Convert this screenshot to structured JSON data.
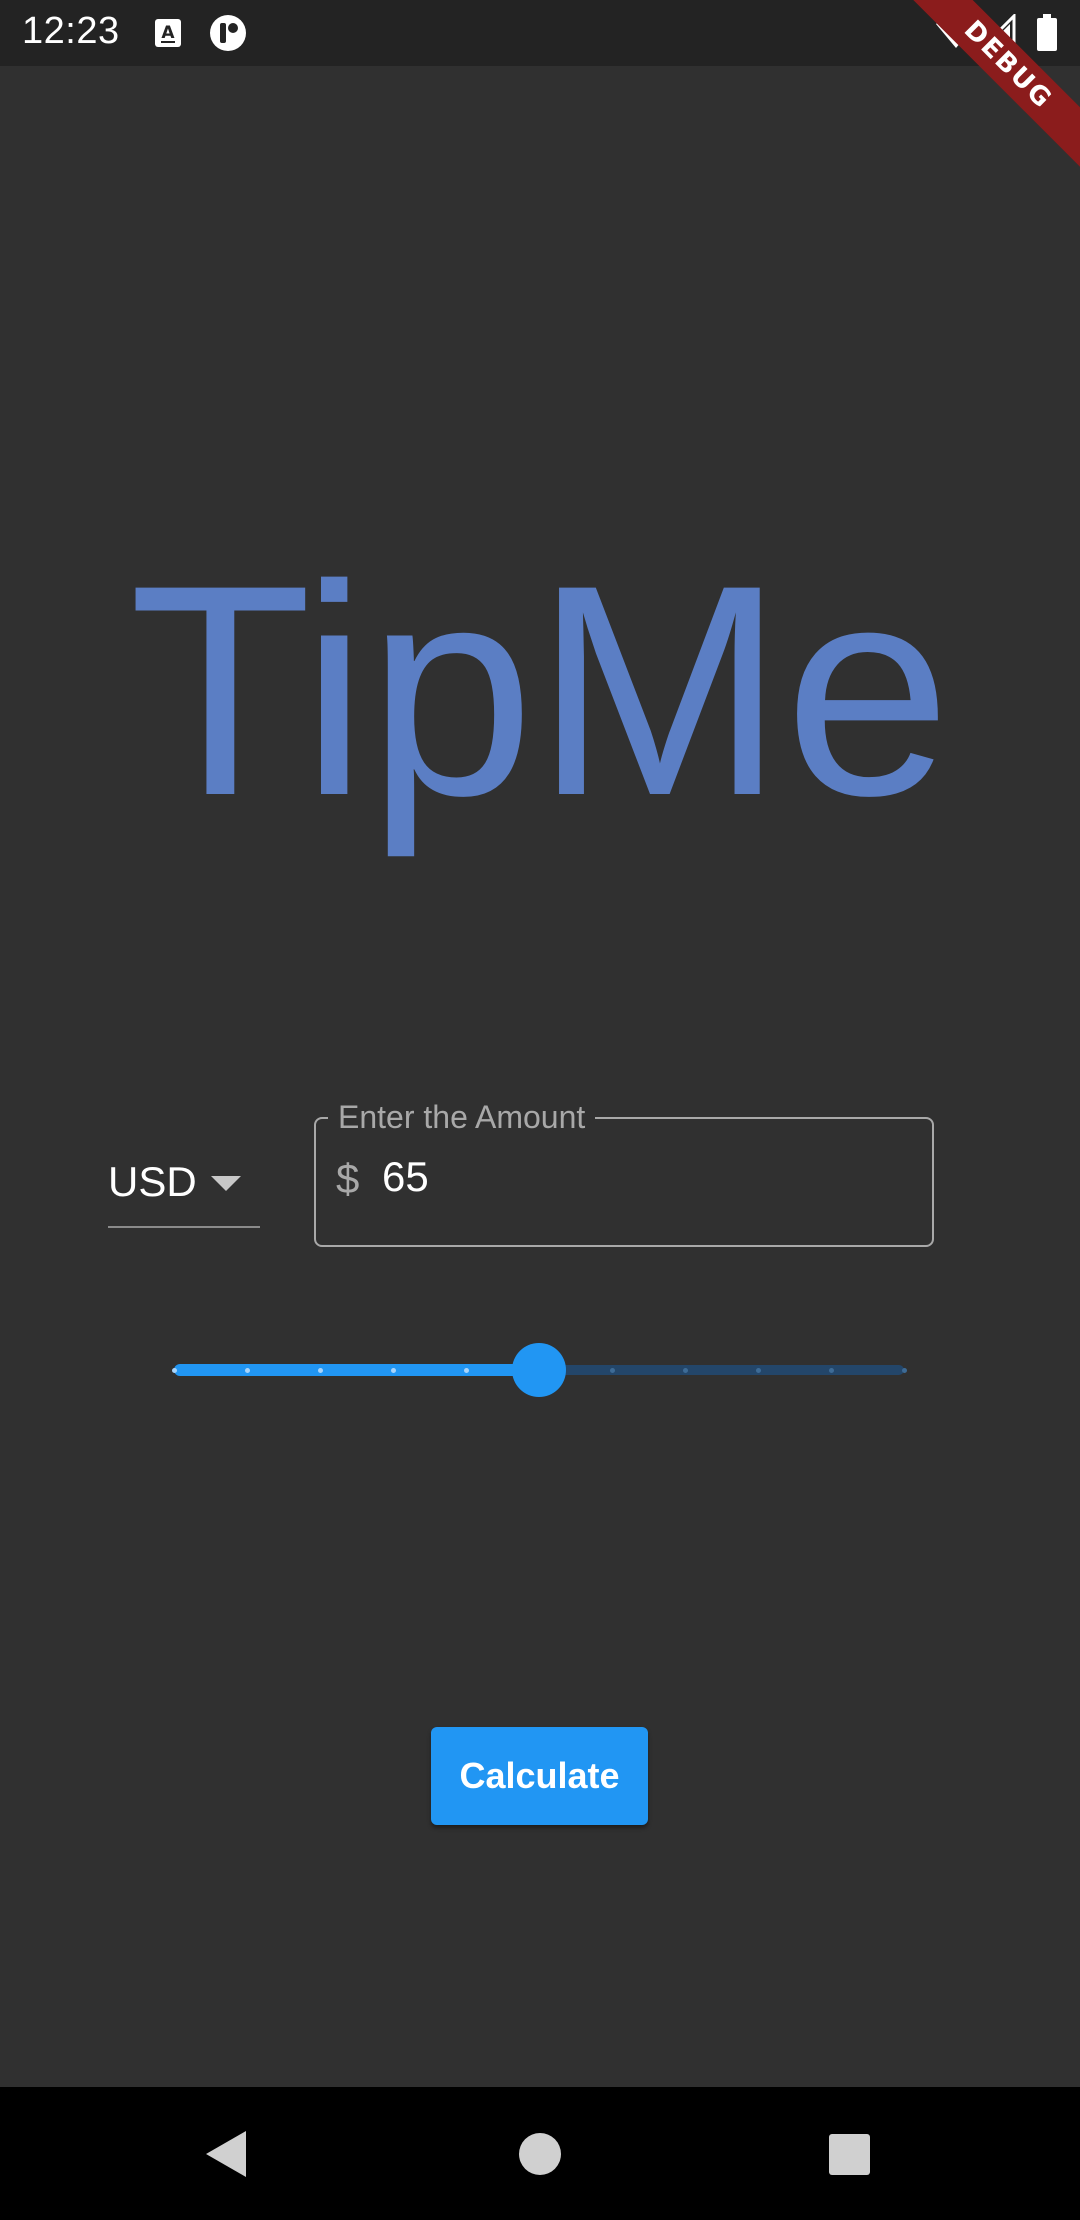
{
  "status_bar": {
    "time": "12:23",
    "icons": [
      "text-a-icon",
      "ring-icon",
      "wifi-icon",
      "signal-icon",
      "battery-icon"
    ],
    "debug_banner": "DEBUG"
  },
  "app": {
    "title": "TipMe",
    "title_color": "#5b7ec4"
  },
  "currency": {
    "selected": "USD"
  },
  "amount_field": {
    "label": "Enter the Amount",
    "prefix": "$",
    "value": "65"
  },
  "tip_slider": {
    "value_fraction": 0.5,
    "divisions": 10,
    "active_color": "#2196f3",
    "inactive_color": "#23466a"
  },
  "calculate_button": {
    "label": "Calculate",
    "color": "#2196f3"
  },
  "nav_bar": {
    "buttons": [
      "back-icon",
      "home-icon",
      "recent-apps-icon"
    ]
  }
}
